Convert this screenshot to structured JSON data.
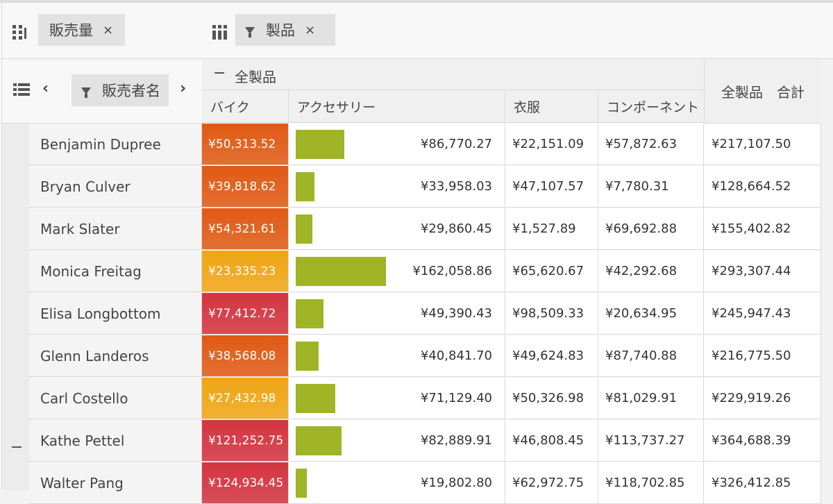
{
  "data_zone": {
    "field": "販売量",
    "remove": "×"
  },
  "column_zone": {
    "field": "製品",
    "remove": "×"
  },
  "row_zone": {
    "field": "販売者名",
    "prev": "‹",
    "next": "›"
  },
  "column_group": {
    "toggle": "−",
    "label": "全製品"
  },
  "total_header": "全製品　合計",
  "columns": [
    "バイク",
    "アクセサリー",
    "衣服",
    "コンポーネント"
  ],
  "colors": {
    "accessory_bar": "#9fb526",
    "bike_red": "#d3343f",
    "bike_orange": "#e05a14",
    "bike_amber": "#f0a515"
  },
  "rows": [
    {
      "name": "Benjamin Dupree",
      "bike": "¥50,313.52",
      "bike_color": "orange",
      "acc": "¥86,770.27",
      "acc_ratio": 0.535,
      "cloth": "¥22,151.09",
      "comp": "¥57,872.63",
      "total": "¥217,107.50"
    },
    {
      "name": "Bryan Culver",
      "bike": "¥39,818.62",
      "bike_color": "orange",
      "acc": "¥33,958.03",
      "acc_ratio": 0.21,
      "cloth": "¥47,107.57",
      "comp": "¥7,780.31",
      "total": "¥128,664.52"
    },
    {
      "name": "Mark Slater",
      "bike": "¥54,321.61",
      "bike_color": "orange",
      "acc": "¥29,860.45",
      "acc_ratio": 0.184,
      "cloth": "¥1,527.89",
      "comp": "¥69,692.88",
      "total": "¥155,402.82"
    },
    {
      "name": "Monica Freitag",
      "bike": "¥23,335.23",
      "bike_color": "amber",
      "acc": "¥162,058.86",
      "acc_ratio": 1.0,
      "cloth": "¥65,620.67",
      "comp": "¥42,292.68",
      "total": "¥293,307.44"
    },
    {
      "name": "Elisa Longbottom",
      "bike": "¥77,412.72",
      "bike_color": "red",
      "acc": "¥49,390.43",
      "acc_ratio": 0.305,
      "cloth": "¥98,509.33",
      "comp": "¥20,634.95",
      "total": "¥245,947.43"
    },
    {
      "name": "Glenn Landeros",
      "bike": "¥38,568.08",
      "bike_color": "orange",
      "acc": "¥40,841.70",
      "acc_ratio": 0.252,
      "cloth": "¥49,624.83",
      "comp": "¥87,740.88",
      "total": "¥216,775.50"
    },
    {
      "name": "Carl Costello",
      "bike": "¥27,432.98",
      "bike_color": "amber",
      "acc": "¥71,129.40",
      "acc_ratio": 0.439,
      "cloth": "¥50,326.98",
      "comp": "¥81,029.91",
      "total": "¥229,919.26"
    },
    {
      "name": "Kathe Pettel",
      "bike": "¥121,252.75",
      "bike_color": "red",
      "acc": "¥82,889.91",
      "acc_ratio": 0.511,
      "cloth": "¥46,808.45",
      "comp": "¥113,737.27",
      "total": "¥364,688.39"
    },
    {
      "name": "Walter Pang",
      "bike": "¥124,934.45",
      "bike_color": "red",
      "acc": "¥19,802.80",
      "acc_ratio": 0.122,
      "cloth": "¥62,972.75",
      "comp": "¥118,702.85",
      "total": "¥326,412.85"
    }
  ]
}
